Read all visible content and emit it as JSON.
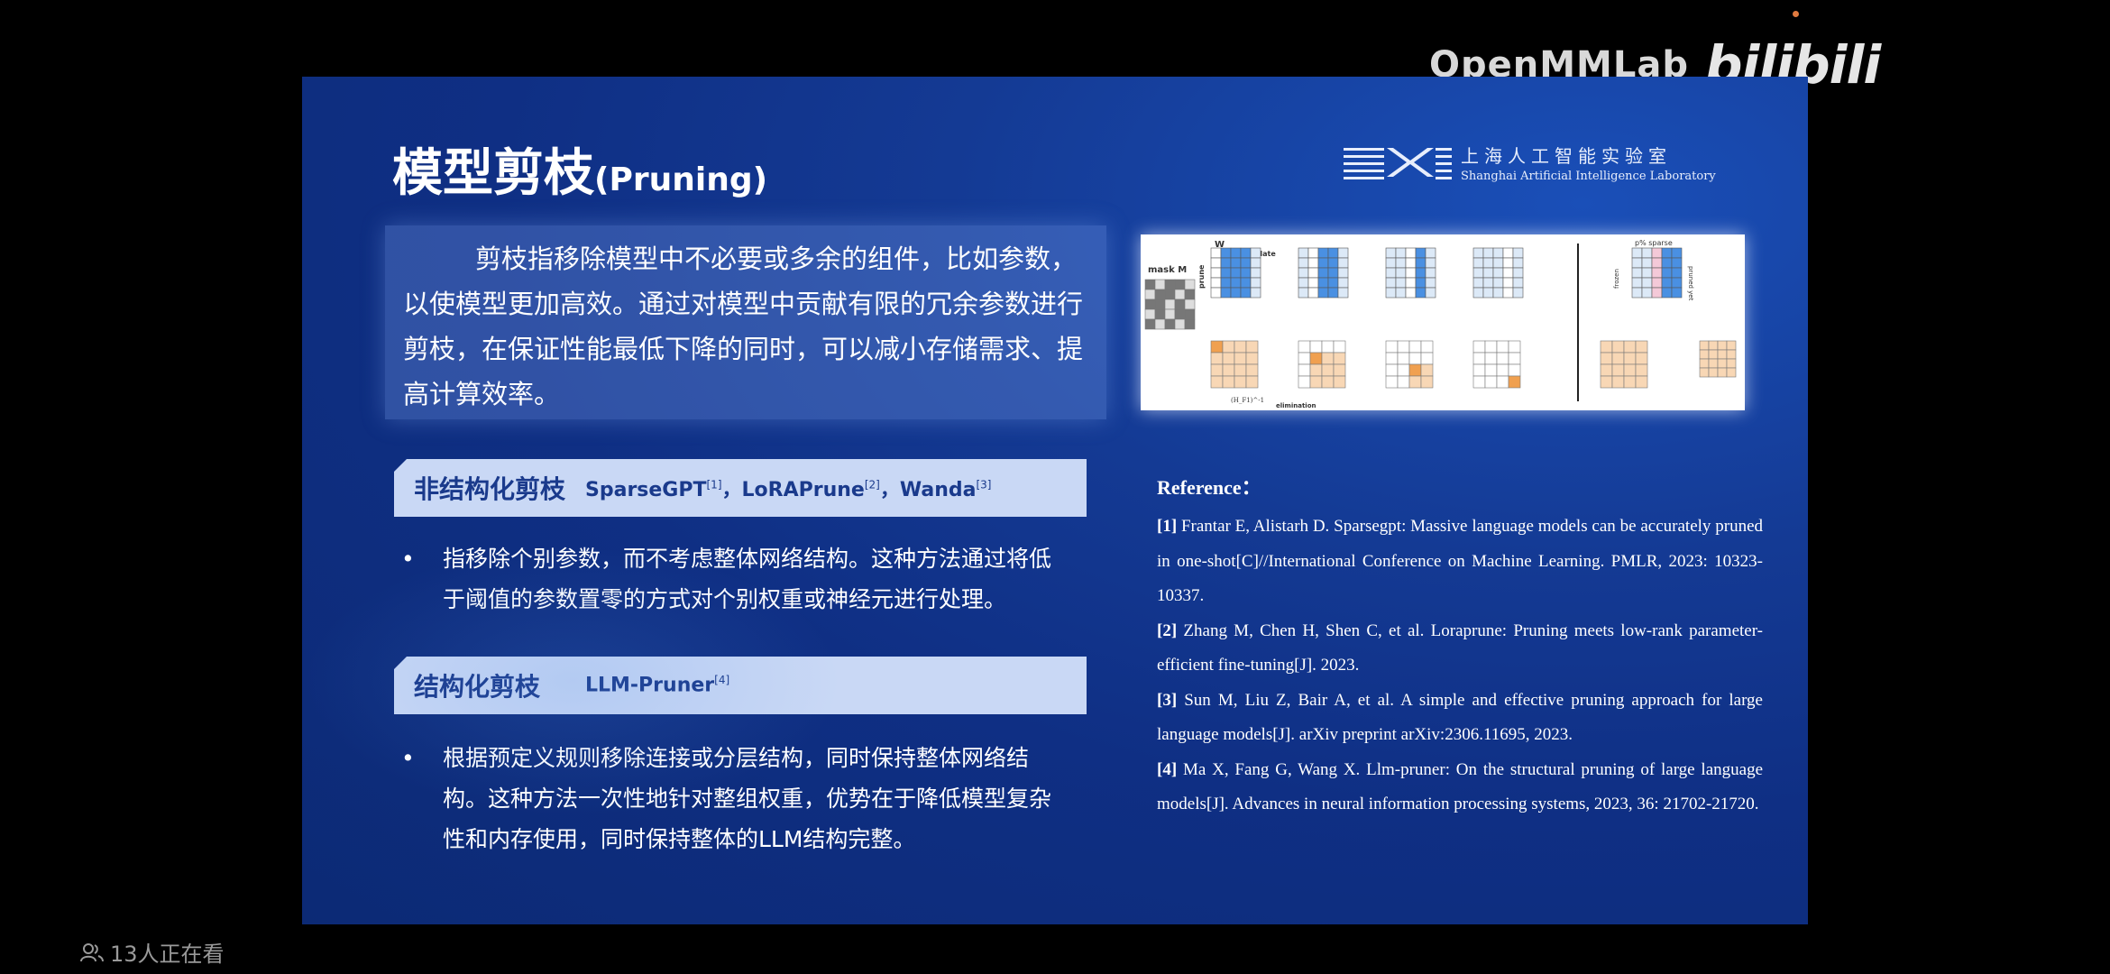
{
  "overlay": {
    "openmmlab": "OpenMMLab",
    "bilibili": "bilibili",
    "viewers": "13人正在看"
  },
  "slide": {
    "title_zh": "模型剪枝",
    "title_en": "(Pruning)",
    "lab_cn": "上海人工智能实验室",
    "lab_en": "Shanghai Artificial Intelligence Laboratory",
    "intro": "剪枝指移除模型中不必要或多余的组件，比如参数，以使模型更加高效。通过对模型中贡献有限的冗余参数进行剪枝，在保证性能最低下降的同时，可以减小存储需求、提高计算效率。",
    "sec1": {
      "title": "非结构化剪枝",
      "r1": "SparseGPT",
      "s1": "[1]",
      "sep1": "，",
      "r2": "LoRAPrune",
      "s2": "[2]",
      "sep2": "，",
      "r3": "Wanda",
      "s3": "[3]",
      "bullet": "指移除个别参数，而不考虑整体网络结构。这种方法通过将低于阈值的参数置零的方式对个别权重或神经元进行处理。"
    },
    "sec2": {
      "title": "结构化剪枝",
      "r1": "LLM-Pruner",
      "s1": "[4]",
      "bullet": "根据预定义规则移除连接或分层结构，同时保持整体网络结构。这种方法一次性地针对整组权重，优势在于降低模型复杂性和内存使用，同时保持整体的LLM结构完整。"
    },
    "figure": {
      "mask": "mask M",
      "w": "W",
      "update": "update",
      "prune": "prune",
      "elimination": "elimination",
      "h1": "(H_F1)^-1",
      "sparse": "p% sparse",
      "frozen": "frozen",
      "pruned": "pruned yet"
    },
    "references": {
      "title": "Reference：",
      "items": [
        {
          "n": "[1]",
          "t": "Frantar E, Alistarh D. Sparsegpt: Massive language models can be accurately pruned in one-shot[C]//International Conference on Machine Learning. PMLR, 2023: 10323-10337."
        },
        {
          "n": "[2]",
          "t": "Zhang M, Chen H, Shen C, et al. Loraprune: Pruning meets low-rank parameter-efficient fine-tuning[J]. 2023."
        },
        {
          "n": "[3]",
          "t": "Sun M, Liu Z, Bair A, et al. A simple and effective pruning approach for large language models[J]. arXiv preprint arXiv:2306.11695, 2023."
        },
        {
          "n": "[4]",
          "t": "Ma X, Fang G, Wang X. Llm-pruner: On the structural pruning of large language models[J]. Advances in neural information processing systems, 2023, 36: 21702-21720."
        }
      ]
    }
  }
}
